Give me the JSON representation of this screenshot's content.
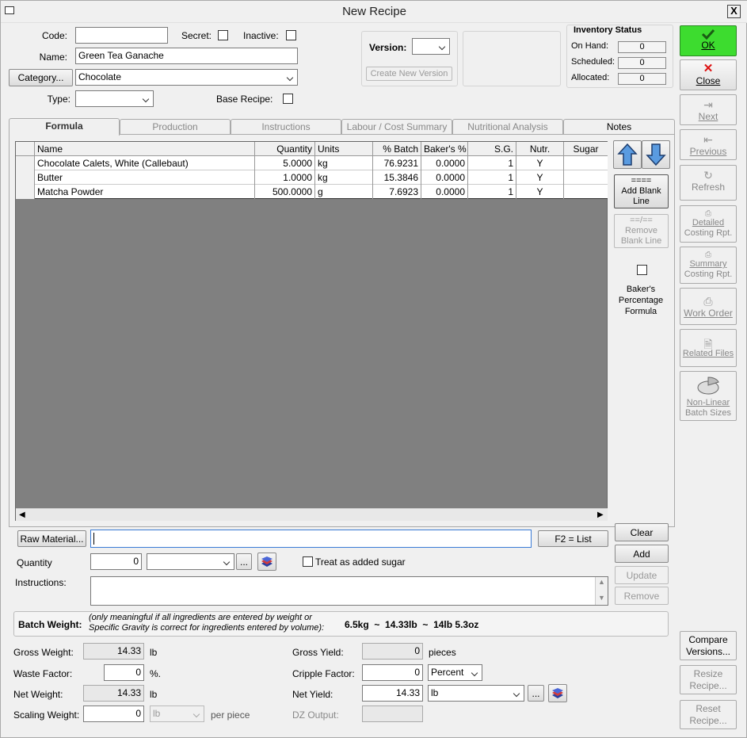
{
  "window": {
    "title": "New Recipe",
    "close_label": "X"
  },
  "form": {
    "code_label": "Code:",
    "code_value": "",
    "secret_label": "Secret:",
    "inactive_label": "Inactive:",
    "name_label": "Name:",
    "name_value": "Green Tea Ganache",
    "category_button": "Category...",
    "category_value": "Chocolate",
    "type_label": "Type:",
    "type_value": "",
    "base_recipe_label": "Base Recipe:"
  },
  "version": {
    "label": "Version:",
    "value": "",
    "create_button": "Create New Version"
  },
  "inventory": {
    "title": "Inventory Status",
    "on_hand_label": "On Hand:",
    "on_hand": "0",
    "scheduled_label": "Scheduled:",
    "scheduled": "0",
    "allocated_label": "Allocated:",
    "allocated": "0"
  },
  "tabs": [
    "Formula",
    "Production",
    "Instructions",
    "Labour / Cost Summary",
    "Nutritional Analysis",
    "Notes"
  ],
  "grid": {
    "columns": [
      "Name",
      "Quantity",
      "Units",
      "% Batch",
      "Baker's %",
      "S.G.",
      "Nutr.",
      "Sugar"
    ],
    "rows": [
      [
        "Chocolate Calets, White (Callebaut)",
        "5.0000",
        "kg",
        "76.9231",
        "0.0000",
        "1",
        "Y",
        ""
      ],
      [
        "Butter",
        "1.0000",
        "kg",
        "15.3846",
        "0.0000",
        "1",
        "Y",
        ""
      ],
      [
        "Matcha Powder",
        "500.0000",
        "g",
        "7.6923",
        "0.0000",
        "1",
        "Y",
        ""
      ]
    ]
  },
  "side": {
    "add_blank_top": "====",
    "add_blank": "Add Blank Line",
    "remove_blank_top": "==/==",
    "remove_blank": "Remove Blank Line",
    "bakers_pct": "Baker's Percentage Formula"
  },
  "entry": {
    "raw_material_button": "Raw Material...",
    "raw_material_value": "",
    "f2_button": "F2 = List",
    "clear_button": "Clear",
    "add_button": "Add",
    "update_button": "Update",
    "remove_button": "Remove",
    "quantity_label": "Quantity",
    "quantity_value": "0",
    "unit_value": "",
    "ellipsis": "...",
    "sugar_label": "Treat as added sugar",
    "instructions_label": "Instructions:"
  },
  "batch": {
    "label": "Batch Weight:",
    "note": "(only meaningful if all ingredients are entered by weight or Specific Gravity is correct for ingredients entered by volume):",
    "value": "6.5kg  ~  14.33lb  ~  14lb 5.3oz"
  },
  "weights": {
    "gross_label": "Gross Weight:",
    "gross_value": "14.33",
    "gross_unit": "lb",
    "waste_label": "Waste Factor:",
    "waste_value": "0",
    "waste_unit": "%.",
    "net_label": "Net Weight:",
    "net_value": "14.33",
    "net_unit": "lb",
    "scaling_label": "Scaling Weight:",
    "scaling_value": "0",
    "scaling_unit": "lb",
    "per_piece": "per piece",
    "gross_yield_label": "Gross Yield:",
    "gross_yield_value": "0",
    "gross_yield_unit": "pieces",
    "cripple_label": "Cripple Factor:",
    "cripple_value": "0",
    "cripple_unit": "Percent",
    "net_yield_label": "Net Yield:",
    "net_yield_value": "14.33",
    "net_yield_unit": "lb",
    "dz_label": "DZ Output:",
    "dz_value": ""
  },
  "right": {
    "ok": "OK",
    "close": "Close",
    "next": "Next",
    "previous": "Previous",
    "refresh": "Refresh",
    "detailed_1": "Detailed",
    "detailed_2": "Costing Rpt.",
    "summary_1": "Summary",
    "summary_2": "Costing Rpt.",
    "work_order": "Work Order",
    "related_files": "Related Files",
    "nonlinear_1": "Non-Linear",
    "nonlinear_2": "Batch Sizes",
    "compare_1": "Compare",
    "compare_2": "Versions...",
    "resize_1": "Resize",
    "resize_2": "Recipe...",
    "reset_1": "Reset",
    "reset_2": "Recipe..."
  }
}
